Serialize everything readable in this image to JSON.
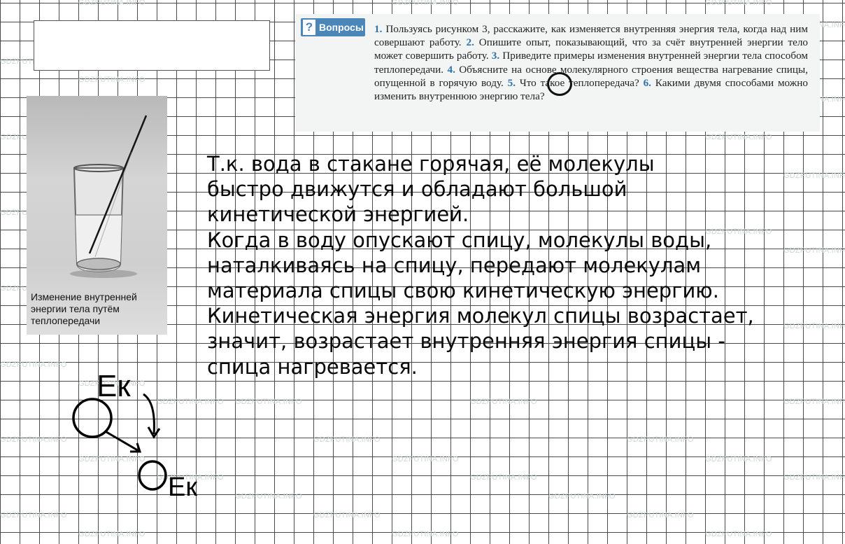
{
  "watermark": "GDZPUTINA.INFO",
  "questions_box": {
    "badge_label": "Вопросы",
    "badge_icon": "question-mark-icon",
    "badge_color": "#4a87b8",
    "items": [
      {
        "num": "1.",
        "text": "Пользуясь рисунком 3, расскажите, как изменяется внутренняя энергия тела, когда над ним совершают работу."
      },
      {
        "num": "2.",
        "text": "Опишите опыт, показывающий, что за счёт внутренней энергии тело может совершить работу."
      },
      {
        "num": "3.",
        "text": "Приведите примеры изменения внутренней энергии тела способом теплопередачи."
      },
      {
        "num": "4.",
        "text": "Объясните на основе молекулярного строения вещества нагревание спицы, опущенной в горячую воду."
      },
      {
        "num": "5.",
        "text": "Что такое теплопередача?"
      },
      {
        "num": "6.",
        "text": "Какими двумя способами можно изменить внутреннюю энергию тела?"
      }
    ]
  },
  "figure": {
    "caption": "Изменение внутренней энергии тела путём теплопередачи"
  },
  "answer": {
    "lines": [
      "Т.к. вода в стакане горячая, её молекулы",
      "быстро движутся и обладают большой",
      "кинетической энергией.",
      "Когда в воду опускают спицу, молекулы воды,",
      "наталкиваясь на спицу, передают молекулам",
      "материала спицы свою кинетическую энергию.",
      "Кинетическая энергия молекул спицы возрастает,",
      "значит, возрастает внутренняя энергия спицы -",
      "спица нагревается."
    ]
  },
  "sketch": {
    "top_label": "Eк",
    "bottom_label": "Eк"
  }
}
